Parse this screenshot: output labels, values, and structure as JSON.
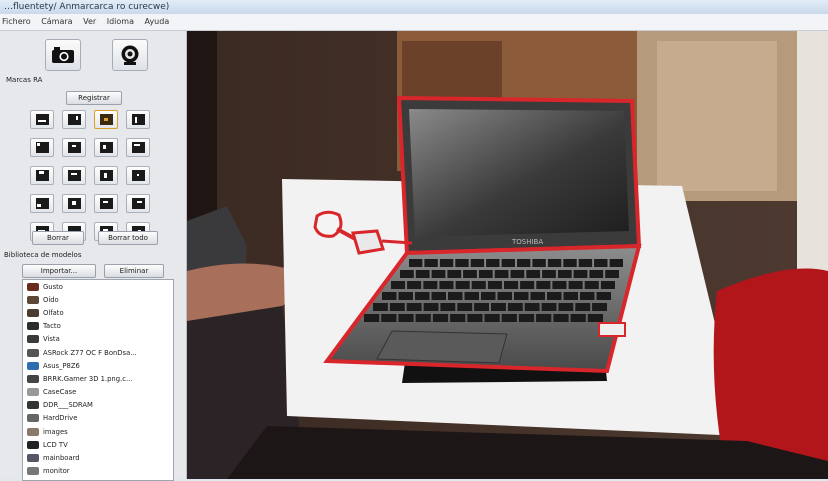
{
  "window": {
    "title": "…fluentety/ Anmarcarca ro curecwe)"
  },
  "menu": [
    "Fichero",
    "Cámara",
    "Ver",
    "Idioma",
    "Ayuda"
  ],
  "toolbar": {
    "camera_icon": "camera-icon",
    "webcam_icon": "webcam-icon"
  },
  "markers": {
    "section_label": "Marcas RA",
    "register_button": "Registrar",
    "delete_button": "Borrar",
    "delete_all_button": "Borrar todo",
    "selected_index": 2,
    "count": 20
  },
  "library": {
    "section_label": "Biblioteca de modelos",
    "import_button": "Importar...",
    "remove_button": "Eliminar",
    "items": [
      "Gusto",
      "Oído",
      "Olfato",
      "Tacto",
      "Vista",
      "ASRock Z77 OC F BonDsa...",
      "Asus_P8Z6",
      "BRRK.Gamer 3D 1.png.c...",
      "CaseCase",
      "DDR___SDRAM",
      "HardDrive",
      "images",
      "LCD TV",
      "mainboard",
      "monitor"
    ]
  },
  "scene": {
    "laptop_brand": "TOSHIBA",
    "outline_color": "#d8262b"
  }
}
